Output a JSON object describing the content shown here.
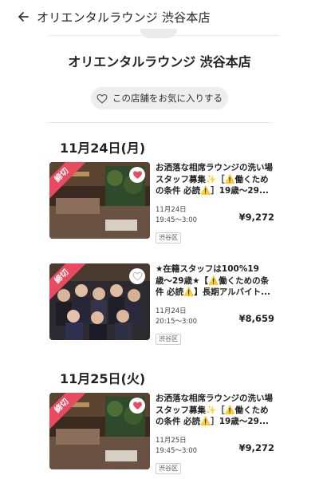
{
  "header": {
    "title": "オリエンタルラウンジ 渋谷本店",
    "back_icon": "arrow-left-icon"
  },
  "shop": {
    "name": "オリエンタルラウンジ 渋谷本店",
    "favorite_label": "この店舗をお気に入りする"
  },
  "groups": [
    {
      "date_heading": "11月24日(月)",
      "jobs": [
        {
          "closed_label": "締切",
          "favorited": true,
          "title": "お洒落な相席ラウンジの洗い場スタッフ募集✨［⚠️働くための条件 必読⚠️］19歳〜29...",
          "date": "11月24日",
          "time": "19:45〜3:00",
          "price": "¥9,272",
          "area": "渋谷区"
        },
        {
          "closed_label": "締切",
          "favorited": false,
          "title": "★在籍スタッフは100%19歳〜29歳★【⚠️働くための条件 必読⚠️】長期アルバイト...",
          "date": "11月24日",
          "time": "20:15〜3:00",
          "price": "¥8,659",
          "area": "渋谷区"
        }
      ]
    },
    {
      "date_heading": "11月25日(火)",
      "jobs": [
        {
          "closed_label": "締切",
          "favorited": true,
          "title": "お洒落な相席ラウンジの洗い場スタッフ募集✨［⚠️働くための条件 必読⚠️］19歳〜29...",
          "date": "11月25日",
          "time": "19:45〜3:00",
          "price": "¥9,272",
          "area": "渋谷区"
        }
      ]
    }
  ],
  "colors": {
    "accent": "#e84a5f",
    "favorite_bg": "#eeeeee",
    "text": "#222222"
  }
}
